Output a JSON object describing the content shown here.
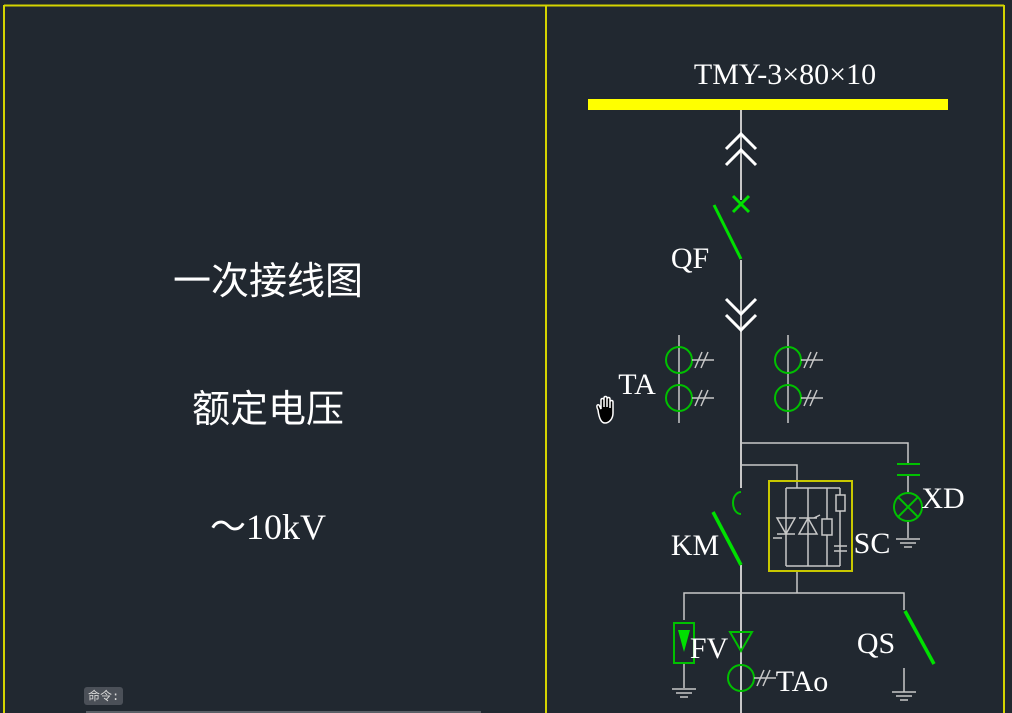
{
  "title_block": {
    "title": "一次接线图",
    "voltage_label": "额定电压",
    "voltage_value": "～10kV"
  },
  "busbar": {
    "label": "TMY-3×80×10",
    "color": "#ffff00"
  },
  "components": {
    "breaker": "QF",
    "current_transformer": "TA",
    "contactor": "KM",
    "controller": "SC",
    "indicator_lamp": "XD",
    "surge_arrester": "FV",
    "zero_sequence_ct": "TAo",
    "earthing_switch": "QS"
  },
  "colors": {
    "background": "#212830",
    "frame": "#d4d400",
    "wire": "#c8c8c8",
    "device_green": "#00e000",
    "symbol_green": "#00c000",
    "text": "#ffffff"
  },
  "command_line": {
    "prompt": "命令:"
  }
}
